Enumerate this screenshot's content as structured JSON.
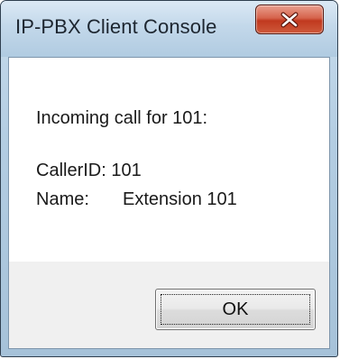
{
  "window": {
    "title": "IP-PBX Client Console"
  },
  "titlebar": {
    "close_icon": "close-icon",
    "close_color": "#c0391f"
  },
  "message": {
    "incoming": "Incoming call for 101:",
    "callerid": "CallerID: 101",
    "name_label": "Name:",
    "name_value": "Extension 101"
  },
  "buttons": {
    "ok_label": "OK"
  }
}
